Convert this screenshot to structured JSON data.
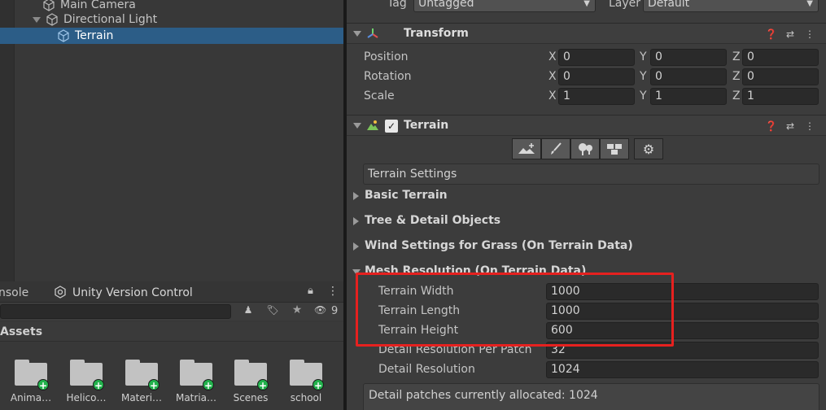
{
  "hierarchy": {
    "items": [
      {
        "label": "Main Camera"
      },
      {
        "label": "Directional Light"
      },
      {
        "label": "Terrain"
      }
    ]
  },
  "inspector": {
    "tag_label": "Tag",
    "tag_value": "Untagged",
    "layer_label": "Layer",
    "layer_value": "Default",
    "transform": {
      "title": "Transform",
      "rows": [
        {
          "label": "Position",
          "x": "0",
          "y": "0",
          "z": "0"
        },
        {
          "label": "Rotation",
          "x": "0",
          "y": "0",
          "z": "0"
        },
        {
          "label": "Scale",
          "x": "1",
          "y": "1",
          "z": "1"
        }
      ],
      "axes": [
        "X",
        "Y",
        "Z"
      ]
    },
    "terrain": {
      "title": "Terrain",
      "enabled": true,
      "tools": [
        "raise-terrain-icon",
        "paint-brush-icon",
        "paint-trees-icon",
        "paint-details-icon",
        "settings-gear-icon"
      ],
      "settings_label": "Terrain Settings",
      "sections": [
        {
          "label": "Basic Terrain"
        },
        {
          "label": "Tree & Detail Objects"
        },
        {
          "label": "Wind Settings for Grass (On Terrain Data)"
        },
        {
          "label": "Mesh Resolution (On Terrain Data)"
        }
      ],
      "mesh_fields": [
        {
          "label": "Terrain Width",
          "value": "1000"
        },
        {
          "label": "Terrain Length",
          "value": "1000"
        },
        {
          "label": "Terrain Height",
          "value": "600"
        },
        {
          "label": "Detail Resolution Per Patch",
          "value": "32"
        },
        {
          "label": "Detail Resolution",
          "value": "1024"
        }
      ],
      "info_text": "Detail patches currently allocated: 1024"
    }
  },
  "bottom": {
    "tabs": [
      {
        "label": "nsole"
      },
      {
        "label": "Unity Version Control"
      }
    ],
    "hidden_count": "9",
    "assets_title": "Assets",
    "assets": [
      {
        "label": "Anima…"
      },
      {
        "label": "Helico…"
      },
      {
        "label": "Materi…"
      },
      {
        "label": "Matria…"
      },
      {
        "label": "Scenes"
      },
      {
        "label": "school"
      }
    ]
  },
  "colors": {
    "selection": "#2c5d87",
    "highlight_box": "#e6211f",
    "add_badge": "#22b14c"
  }
}
